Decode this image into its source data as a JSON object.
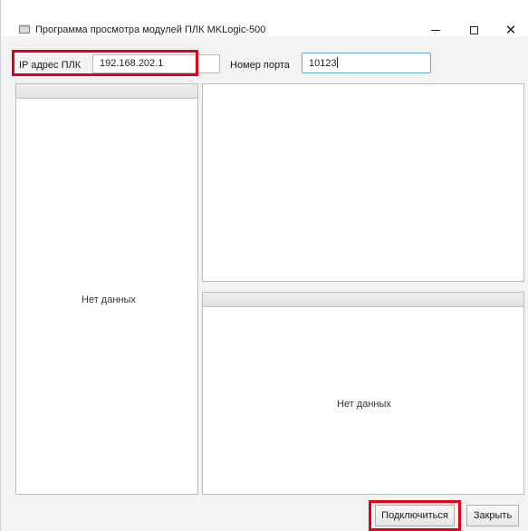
{
  "window": {
    "title": "Программа просмотра модулей ПЛК MKLogic-500",
    "app_icon": "window-app-icon",
    "controls": {
      "minimize_icon": "minimize-icon",
      "maximize_icon": "maximize-icon",
      "close_glyph": "✕"
    }
  },
  "connection": {
    "ip_label": "IP адрес ПЛК",
    "ip_value": "192.168.202.1",
    "port_label": "Номер порта",
    "port_value": "10123"
  },
  "panels": {
    "modules_empty_text": "Нет данных",
    "details_empty_text": "Нет данных"
  },
  "buttons": {
    "connect_label": "Подключиться",
    "close_label": "Закрыть"
  },
  "colors": {
    "highlight": "#e3001b",
    "focus_border": "#5fa9c8"
  }
}
